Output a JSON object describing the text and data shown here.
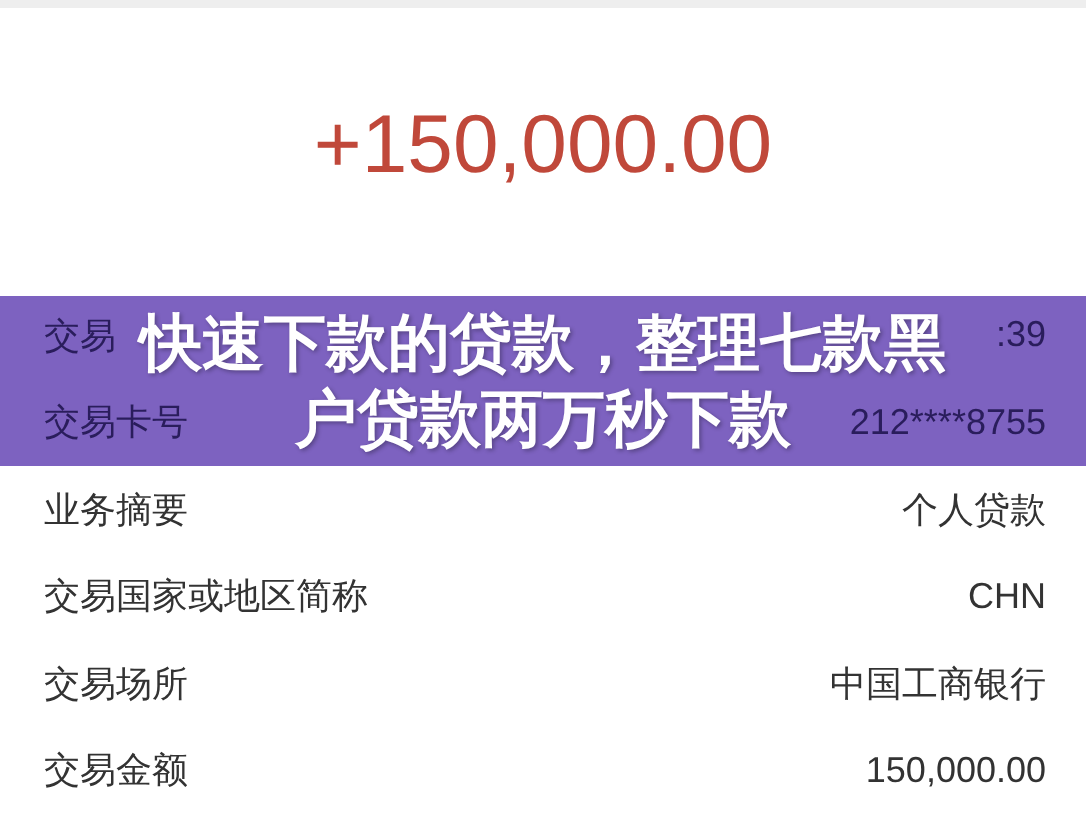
{
  "amount": "+150,000.00",
  "rows": [
    {
      "label": "交易",
      "value": ":39"
    },
    {
      "label": "交易卡号",
      "value": "212****8755"
    },
    {
      "label": "业务摘要",
      "value": "个人贷款"
    },
    {
      "label": "交易国家或地区简称",
      "value": "CHN"
    },
    {
      "label": "交易场所",
      "value": "中国工商银行"
    },
    {
      "label": "交易金额",
      "value": "150,000.00"
    }
  ],
  "banner": {
    "title_lines": [
      "快速下款的贷款，整理七款黑",
      "户贷款两万秒下款"
    ]
  }
}
